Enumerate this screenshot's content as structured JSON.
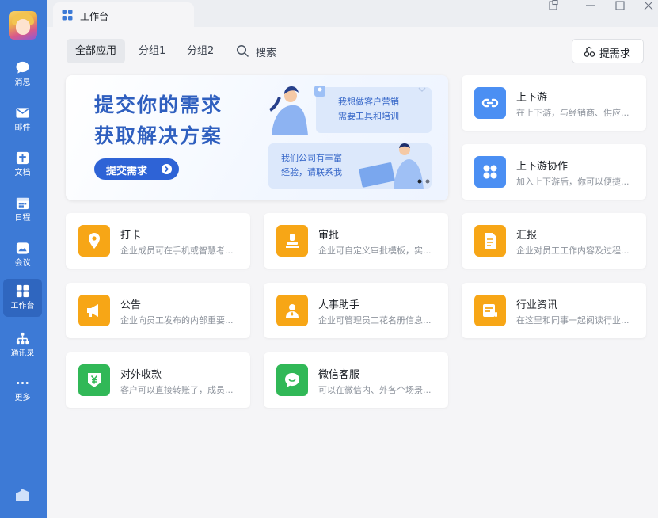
{
  "window": {
    "tab_title": "工作台"
  },
  "sidebar": {
    "items": [
      {
        "label": "消息",
        "icon": "chat-bubble-icon"
      },
      {
        "label": "邮件",
        "icon": "mail-icon"
      },
      {
        "label": "文档",
        "icon": "document-icon"
      },
      {
        "label": "日程",
        "icon": "calendar-icon"
      },
      {
        "label": "会议",
        "icon": "meeting-icon"
      },
      {
        "label": "工作台",
        "icon": "workbench-grid-icon",
        "active": true
      },
      {
        "label": "通讯录",
        "icon": "contacts-icon"
      },
      {
        "label": "更多",
        "icon": "more-dots-icon"
      }
    ]
  },
  "filters": {
    "all": "全部应用",
    "group1": "分组1",
    "group2": "分组2",
    "search": "搜索",
    "request_button": "提需求"
  },
  "banner": {
    "line1": "提交你的需求",
    "line2": "获取解决方案",
    "cta": "提交需求",
    "bubble1_line1": "我想做客户营销",
    "bubble1_line2": "需要工具和培训",
    "bubble2_line1": "我们公司有丰富",
    "bubble2_line2": "经验，请联系我"
  },
  "apps": [
    {
      "title": "上下游",
      "desc": "在上下游，与经销商、供应...",
      "icon": "link-chain-icon",
      "color": "blue"
    },
    {
      "title": "上下游协作",
      "desc": "加入上下游后，你可以便捷...",
      "icon": "collaboration-grid-icon",
      "color": "blue"
    },
    {
      "title": "打卡",
      "desc": "企业成员可在手机或智慧考...",
      "icon": "location-pin-icon",
      "color": "orange"
    },
    {
      "title": "审批",
      "desc": "企业可自定义审批模板，实...",
      "icon": "approval-stamp-icon",
      "color": "orange"
    },
    {
      "title": "汇报",
      "desc": "企业对员工工作内容及过程...",
      "icon": "report-document-icon",
      "color": "orange"
    },
    {
      "title": "公告",
      "desc": "企业向员工发布的内部重要...",
      "icon": "megaphone-icon",
      "color": "orange"
    },
    {
      "title": "人事助手",
      "desc": "企业可管理员工花名册信息...",
      "icon": "hr-person-icon",
      "color": "orange"
    },
    {
      "title": "行业资讯",
      "desc": "在这里和同事一起阅读行业...",
      "icon": "news-icon",
      "color": "orange"
    },
    {
      "title": "对外收款",
      "desc": "客户可以直接转账了，成员...",
      "icon": "yen-shield-icon",
      "color": "green"
    },
    {
      "title": "微信客服",
      "desc": "可以在微信内、外各个场景...",
      "icon": "wechat-service-icon",
      "color": "green"
    }
  ]
}
